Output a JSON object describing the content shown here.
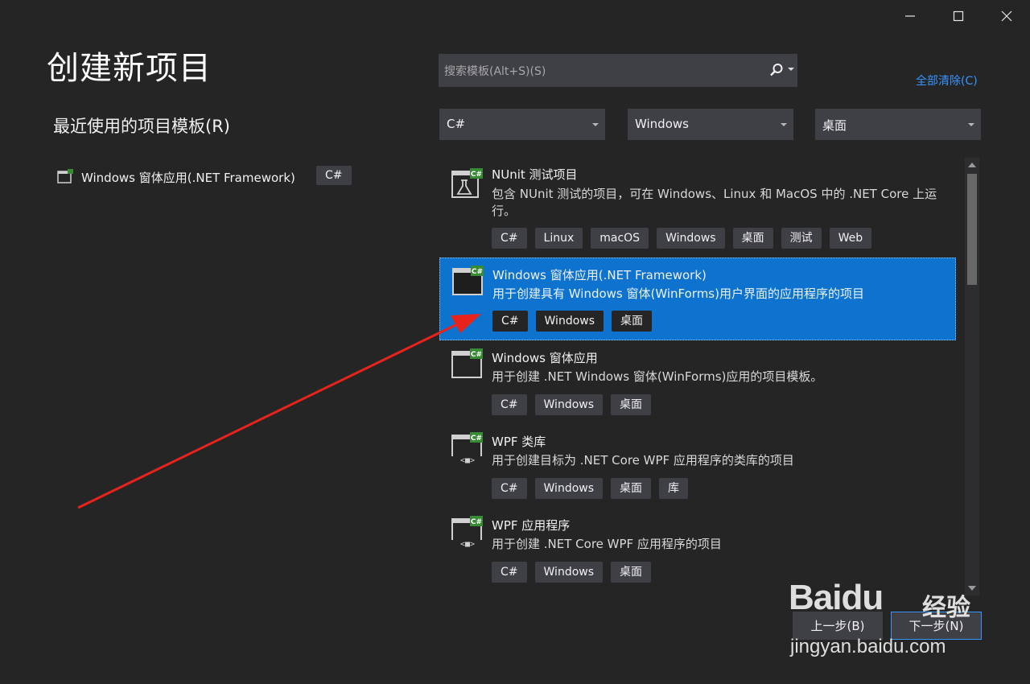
{
  "window": {
    "minimize_icon": "minimize-icon",
    "maximize_icon": "maximize-icon",
    "close_icon": "close-icon"
  },
  "page_title": "创建新项目",
  "recent": {
    "title": "最近使用的项目模板(R)",
    "items": [
      {
        "label": "Windows 窗体应用(.NET Framework)",
        "tag": "C#"
      }
    ]
  },
  "search": {
    "placeholder": "搜索模板(Alt+S)(S)",
    "value": ""
  },
  "clear_all": "全部清除(C)",
  "filters": {
    "language": "C#",
    "platform": "Windows",
    "project_type": "桌面"
  },
  "templates": [
    {
      "name": "NUnit 测试项目",
      "description": "包含 NUnit 测试的项目，可在 Windows、Linux 和 MacOS 中的 .NET Core 上运行。",
      "tags": [
        "C#",
        "Linux",
        "macOS",
        "Windows",
        "桌面",
        "测试",
        "Web"
      ],
      "icon": "test-project-icon",
      "selected": false
    },
    {
      "name": "Windows 窗体应用(.NET Framework)",
      "description": "用于创建具有 Windows 窗体(WinForms)用户界面的应用程序的项目",
      "tags": [
        "C#",
        "Windows",
        "桌面"
      ],
      "icon": "window-app-icon",
      "selected": true
    },
    {
      "name": "Windows 窗体应用",
      "description": "用于创建 .NET Windows 窗体(WinForms)应用的项目模板。",
      "tags": [
        "C#",
        "Windows",
        "桌面"
      ],
      "icon": "window-app-icon",
      "selected": false
    },
    {
      "name": "WPF 类库",
      "description": "用于创建目标为 .NET Core WPF 应用程序的类库的项目",
      "tags": [
        "C#",
        "Windows",
        "桌面",
        "库"
      ],
      "icon": "wpf-library-icon",
      "selected": false
    },
    {
      "name": "WPF 应用程序",
      "description": "用于创建 .NET Core WPF 应用程序的项目",
      "tags": [
        "C#",
        "Windows",
        "桌面"
      ],
      "icon": "wpf-app-icon",
      "selected": false
    }
  ],
  "buttons": {
    "back": "上一步(B)",
    "next": "下一步(N)"
  },
  "watermark": {
    "main": "Baidu",
    "cn": "经验",
    "sub": "jingyan.baidu.com"
  },
  "colors": {
    "background": "#252526",
    "accent": "#0e73cf",
    "link": "#3794ff",
    "annotation_arrow": "#e8231c"
  }
}
